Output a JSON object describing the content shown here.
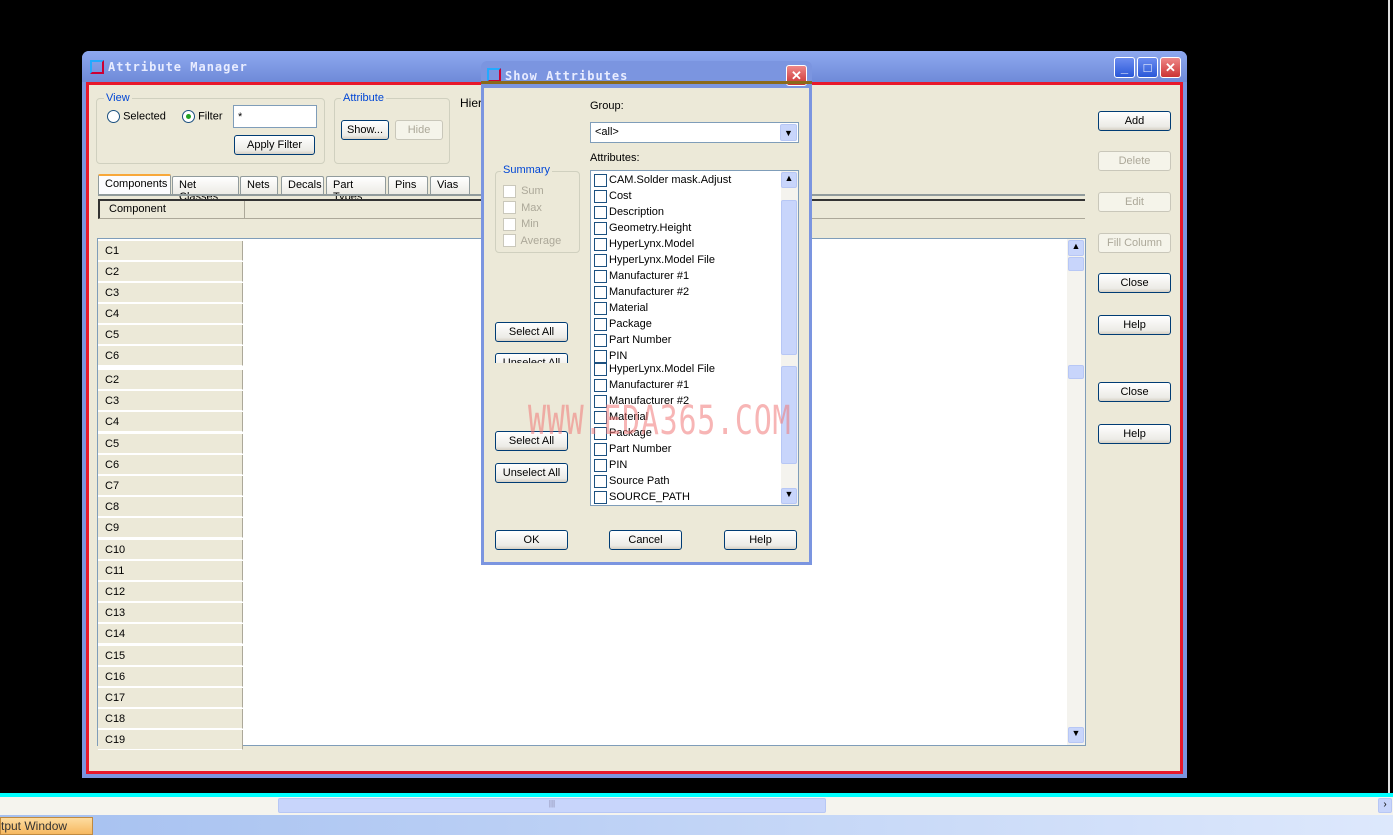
{
  "main_window": {
    "title": "Attribute Manager",
    "view": {
      "label": "View",
      "selected_label": "Selected",
      "filter_label": "Filter",
      "filter_value": "*",
      "apply_filter": "Apply Filter",
      "selected_mode": "Filter"
    },
    "attribute": {
      "label": "Attribute",
      "show": "Show...",
      "hide": "Hide"
    },
    "hierarchy_label": "Hier",
    "tabs": [
      "Components",
      "Net Classes",
      "Nets",
      "Decals",
      "Part Types",
      "Pins",
      "Vias"
    ],
    "active_tab": "Components",
    "column_header": "Component",
    "rows_top": [
      "C1",
      "C2",
      "C3",
      "C4",
      "C5",
      "C6"
    ],
    "rows_bottom": [
      "C2",
      "C3",
      "C4",
      "C5",
      "C6",
      "C7",
      "C8",
      "C9",
      "C10",
      "C11",
      "C12",
      "C13",
      "C14",
      "C15",
      "C16",
      "C17",
      "C18",
      "C19"
    ],
    "buttons": [
      "Add",
      "Delete",
      "Edit",
      "Fill Column",
      "Close",
      "Help",
      "Close",
      "Help"
    ],
    "disabled_buttons": [
      "Delete",
      "Edit",
      "Fill Column"
    ]
  },
  "dialog": {
    "title": "Show Attributes",
    "group_label": "Group:",
    "group_value": "<all>",
    "attributes_label": "Attributes:",
    "summary": {
      "label": "Summary",
      "items": [
        "Sum",
        "Max",
        "Min",
        "Average"
      ]
    },
    "attributes": [
      "CAM.Solder mask.Adjust",
      "Cost",
      "Description",
      "Geometry.Height",
      "HyperLynx.Model",
      "HyperLynx.Model File",
      "Manufacturer #1",
      "Manufacturer #2",
      "Material",
      "Package",
      "Part Number",
      "PIN",
      "HyperLynx.Model File",
      "Manufacturer #1",
      "Manufacturer #2",
      "Material",
      "Package",
      "Part Number",
      "PIN",
      "Source Path",
      "SOURCE_PATH"
    ],
    "select_all": "Select All",
    "unselect_all": "Unselect All",
    "ok": "OK",
    "cancel": "Cancel",
    "help": "Help"
  },
  "watermark": "WWW.EDA365.COM",
  "taskbar": {
    "tab": "tput Window"
  }
}
